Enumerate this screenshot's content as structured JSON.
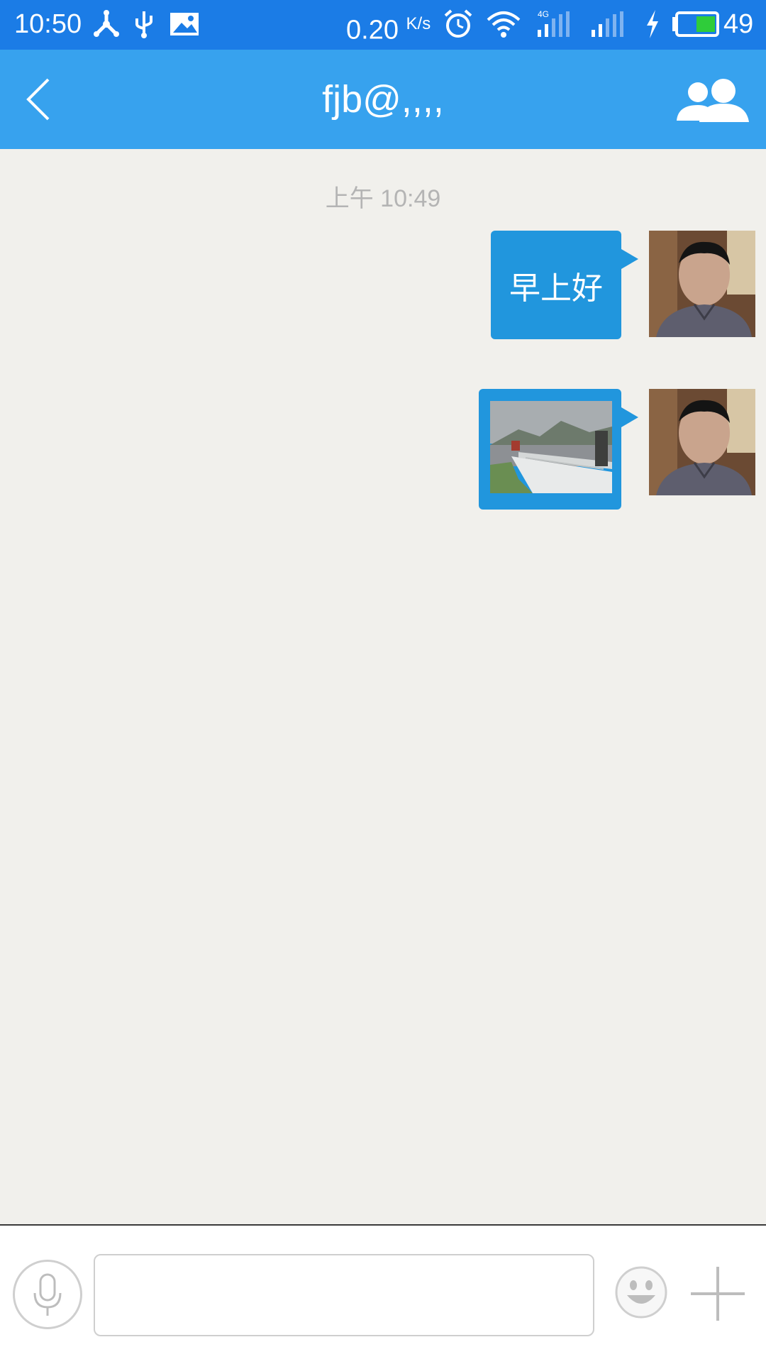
{
  "status_bar": {
    "time": "10:50",
    "net_speed": "0.20",
    "net_speed_unit": "K/s",
    "battery_level": "49",
    "network_type": "4G",
    "icons": [
      "share-icon",
      "usb-icon",
      "image-icon",
      "alarm-icon",
      "wifi-icon",
      "signal-4g-icon",
      "signal-icon",
      "charging-icon",
      "battery-icon"
    ]
  },
  "header": {
    "title": "fjb@,,,,",
    "back_icon": "chevron-left-icon",
    "members_icon": "group-icon"
  },
  "chat": {
    "timestamp": "上午 10:49",
    "messages": [
      {
        "type": "text",
        "text": "早上好",
        "sender": "self"
      },
      {
        "type": "image",
        "sender": "self"
      }
    ]
  },
  "input_bar": {
    "message_value": "",
    "icons": [
      "microphone-icon",
      "emoji-icon",
      "plus-icon"
    ]
  },
  "colors": {
    "status_bar": "#1b7ce6",
    "header": "#37a2ee",
    "bubble": "#2196dd",
    "background": "#f1f0ec"
  }
}
